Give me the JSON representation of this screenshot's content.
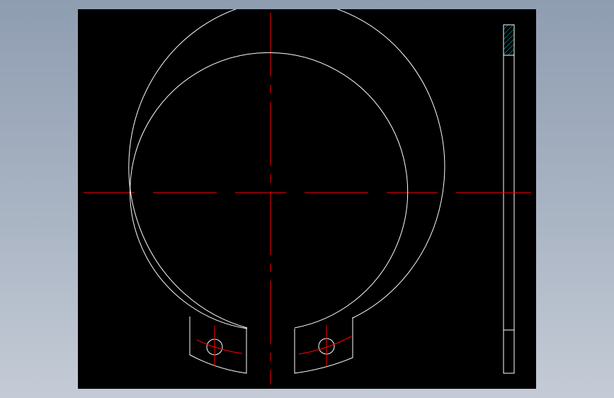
{
  "viewport": {
    "background": "#000000",
    "outline_color": "#ffffff",
    "centerline_color": "#ff0000",
    "hatch_color": "#00c8c8"
  },
  "drawing": {
    "title": "",
    "views": [
      "front-view",
      "side-view"
    ],
    "part": "external-retaining-circlip"
  }
}
